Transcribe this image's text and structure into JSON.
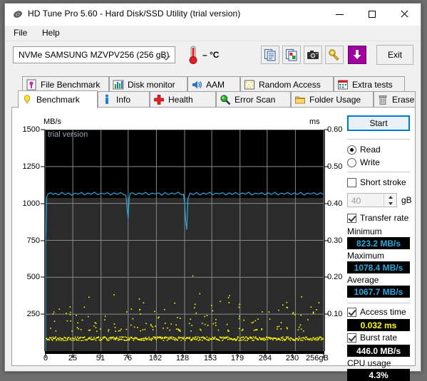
{
  "window": {
    "title": "HD Tune Pro 5.60 - Hard Disk/SSD Utility (trial version)",
    "minimize": "minimize-icon",
    "maximize": "maximize-icon",
    "close": "close-icon"
  },
  "menu": {
    "items": [
      "File",
      "Help"
    ]
  },
  "toolbar": {
    "drive": "NVMe   SAMSUNG MZVPV256 (256 gB)",
    "temperature": "– °C",
    "buttons": [
      {
        "name": "copy-text-icon",
        "label": ""
      },
      {
        "name": "copy-image-icon",
        "label": ""
      },
      {
        "name": "screenshot-icon",
        "label": ""
      },
      {
        "name": "certificate-icon",
        "label": ""
      },
      {
        "name": "save-icon",
        "label": ""
      }
    ],
    "exit_label": "Exit"
  },
  "tabs": {
    "row1": [
      {
        "label": "File Benchmark",
        "icon": "file-benchmark-icon",
        "active": false
      },
      {
        "label": "Disk monitor",
        "icon": "disk-monitor-icon",
        "active": false
      },
      {
        "label": "AAM",
        "icon": "aam-speaker-icon",
        "active": false
      },
      {
        "label": "Random Access",
        "icon": "random-access-icon",
        "active": false
      },
      {
        "label": "Extra tests",
        "icon": "extra-tests-icon",
        "active": false
      }
    ],
    "row2": [
      {
        "label": "Benchmark",
        "icon": "benchmark-bulb-icon",
        "active": true
      },
      {
        "label": "Info",
        "icon": "info-icon",
        "active": false
      },
      {
        "label": "Health",
        "icon": "health-cross-icon",
        "active": false
      },
      {
        "label": "Error Scan",
        "icon": "error-scan-magnifier-icon",
        "active": false
      },
      {
        "label": "Folder Usage",
        "icon": "folder-usage-icon",
        "active": false
      },
      {
        "label": "Erase",
        "icon": "erase-trash-icon",
        "active": false
      }
    ]
  },
  "controls": {
    "start_label": "Start",
    "mode": {
      "read": "Read",
      "write": "Write",
      "selected": "Read"
    },
    "short_stroke": {
      "label": "Short stroke",
      "checked": false,
      "value": "40",
      "unit": "gB"
    },
    "transfer_rate": {
      "label": "Transfer rate",
      "checked": true
    },
    "minimum": {
      "label": "Minimum",
      "value": "823.2 MB/s",
      "color": "#2aa8e0"
    },
    "maximum": {
      "label": "Maximum",
      "value": "1078.4 MB/s",
      "color": "#2aa8e0"
    },
    "average": {
      "label": "Average",
      "value": "1067.7 MB/s",
      "color": "#2aa8e0"
    },
    "access_time": {
      "label": "Access time",
      "checked": true,
      "value": "0.032 ms",
      "color": "#ffff00"
    },
    "burst_rate": {
      "label": "Burst rate",
      "checked": true,
      "value": "446.0 MB/s",
      "color": "#ffffff"
    },
    "cpu_usage": {
      "label": "CPU usage",
      "value": "4.3%",
      "color": "#ffffff"
    }
  },
  "chart_data": {
    "type": "line",
    "title": "",
    "watermark": "trial version",
    "xlabel": "",
    "ylabel": "MB/s",
    "y2label": "ms",
    "xlim": [
      0,
      256
    ],
    "ylim": [
      0,
      1500
    ],
    "y2lim": [
      0,
      0.6
    ],
    "grid": true,
    "xticks": [
      "0",
      "25",
      "51",
      "76",
      "102",
      "128",
      "153",
      "179",
      "204",
      "230",
      "256gB"
    ],
    "xtickvals": [
      0,
      25,
      51,
      76,
      102,
      128,
      153,
      179,
      204,
      230,
      256
    ],
    "yticks": [
      "250",
      "500",
      "750",
      "1000",
      "1250",
      "1500"
    ],
    "ytickvals": [
      250,
      500,
      750,
      1000,
      1250,
      1500
    ],
    "y2ticks": [
      "0.10",
      "0.20",
      "0.30",
      "0.40",
      "0.50",
      "0.60"
    ],
    "y2tickvals": [
      0.1,
      0.2,
      0.3,
      0.4,
      0.5,
      0.6
    ],
    "series": [
      {
        "name": "Transfer rate",
        "axis": "left",
        "color": "#2aa8e0",
        "unit": "MB/s",
        "x": [
          0,
          1,
          2,
          3,
          5,
          7,
          9,
          12,
          15,
          18,
          21,
          24,
          27,
          30,
          33,
          36,
          39,
          42,
          45,
          48,
          51,
          54,
          57,
          60,
          63,
          66,
          69,
          72,
          74,
          75,
          76,
          77,
          78,
          80,
          83,
          86,
          89,
          92,
          95,
          98,
          101,
          104,
          107,
          110,
          113,
          116,
          119,
          122,
          125,
          127,
          128,
          129,
          130,
          131,
          133,
          136,
          139,
          142,
          145,
          148,
          151,
          154,
          157,
          160,
          163,
          166,
          169,
          172,
          175,
          178,
          181,
          184,
          187,
          190,
          193,
          196,
          199,
          202,
          205,
          208,
          211,
          214,
          217,
          220,
          223,
          226,
          229,
          232,
          235,
          238,
          241,
          244,
          247,
          250,
          253,
          256
        ],
        "y": [
          700,
          1040,
          1062,
          1068,
          1072,
          1061,
          1070,
          1058,
          1075,
          1060,
          1072,
          1055,
          1070,
          1063,
          1074,
          1058,
          1071,
          1062,
          1076,
          1059,
          1070,
          1064,
          1073,
          1057,
          1072,
          1061,
          1074,
          1060,
          1055,
          960,
          900,
          1040,
          1068,
          1072,
          1059,
          1071,
          1062,
          1075,
          1058,
          1070,
          1064,
          1072,
          1056,
          1074,
          1060,
          1071,
          1063,
          1076,
          1058,
          1062,
          1000,
          880,
          823,
          1030,
          1070,
          1060,
          1074,
          1057,
          1071,
          1063,
          1075,
          1059,
          1070,
          1064,
          1073,
          1058,
          1072,
          1061,
          1074,
          1060,
          1071,
          1063,
          1076,
          1057,
          1070,
          1064,
          1073,
          1059,
          1072,
          1061,
          1075,
          1058,
          1070,
          1063,
          1074,
          1060,
          1071,
          1062,
          1075,
          1057,
          1070,
          1064,
          1073,
          1059,
          1072,
          1061,
          1068
        ]
      },
      {
        "name": "Access time",
        "axis": "right",
        "color": "#ffff00",
        "unit": "ms",
        "style": "scatter"
      }
    ],
    "stats": {
      "minimum_mbs": 823.2,
      "maximum_mbs": 1078.4,
      "average_mbs": 1067.7,
      "access_time_ms": 0.032,
      "burst_rate_mbs": 446.0,
      "cpu_usage_pct": 4.3
    }
  }
}
